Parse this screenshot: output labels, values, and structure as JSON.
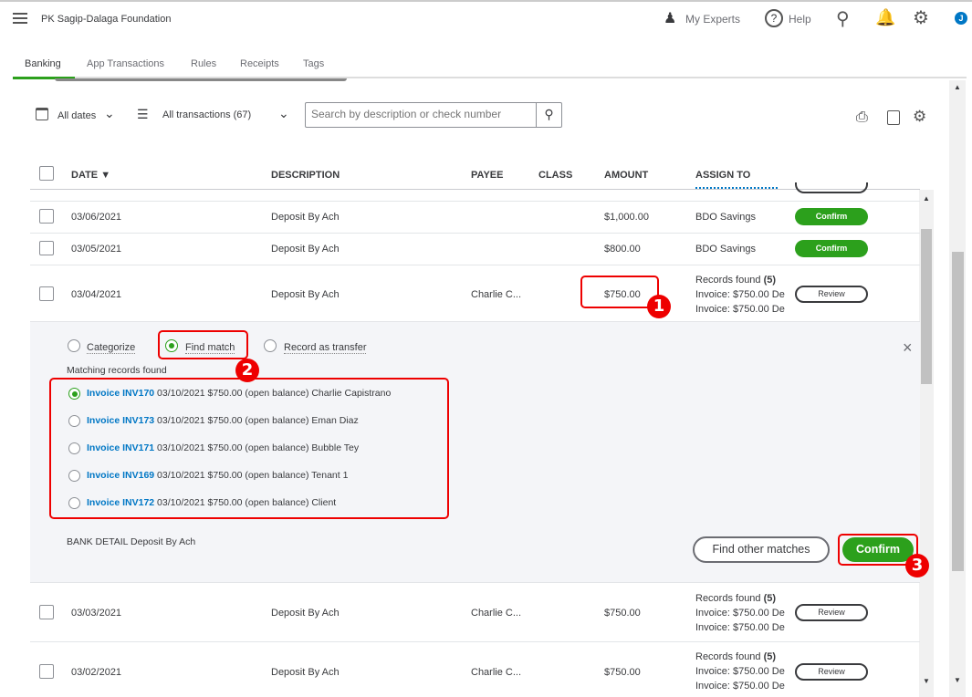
{
  "company": "PK Sagip-Dalaga Foundation",
  "header": {
    "my_experts": "My Experts",
    "help": "Help",
    "avatar": "J"
  },
  "tabs": [
    "Banking",
    "App Transactions",
    "Rules",
    "Receipts",
    "Tags"
  ],
  "filters": {
    "dates": "All dates",
    "transactions": "All transactions (67)",
    "search_placeholder": "Search by description or check number"
  },
  "columns": [
    "DATE",
    "DESCRIPTION",
    "PAYEE",
    "CLASS",
    "AMOUNT",
    "ASSIGN TO"
  ],
  "rows": [
    {
      "date": "03/06/2021",
      "description": "Deposit By Ach",
      "payee": "",
      "amount": "$1,000.00",
      "assign": "BDO Savings",
      "action": "Confirm"
    },
    {
      "date": "03/05/2021",
      "description": "Deposit By Ach",
      "payee": "",
      "amount": "$800.00",
      "assign": "BDO Savings",
      "action": "Confirm"
    },
    {
      "date": "03/04/2021",
      "description": "Deposit By Ach",
      "payee": "Charlie C...",
      "amount": "$750.00",
      "records": "Records found",
      "count": "(5)",
      "inv1": "Invoice: $750.00 De",
      "inv2": "Invoice: $750.00 De",
      "action": "Review"
    },
    {
      "date": "03/03/2021",
      "description": "Deposit By Ach",
      "payee": "Charlie C...",
      "amount": "$750.00",
      "records": "Records found",
      "count": "(5)",
      "inv1": "Invoice: $750.00 De",
      "inv2": "Invoice: $750.00 De",
      "action": "Review"
    },
    {
      "date": "03/02/2021",
      "description": "Deposit By Ach",
      "payee": "Charlie C...",
      "amount": "$750.00",
      "records": "Records found",
      "count": "(5)",
      "inv1": "Invoice: $750.00 De",
      "inv2": "Invoice: $750.00 De",
      "action": "Review"
    }
  ],
  "panel": {
    "opt_categorize": "Categorize",
    "opt_find": "Find match",
    "opt_transfer": "Record as transfer",
    "matching_label": "Matching records found",
    "matches": [
      {
        "inv": "Invoice INV170",
        "detail": "03/10/2021 $750.00 (open balance) Charlie Capistrano"
      },
      {
        "inv": "Invoice INV173",
        "detail": "03/10/2021 $750.00 (open balance) Eman Diaz"
      },
      {
        "inv": "Invoice INV171",
        "detail": "03/10/2021 $750.00 (open balance) Bubble Tey"
      },
      {
        "inv": "Invoice INV169",
        "detail": "03/10/2021 $750.00 (open balance) Tenant 1"
      },
      {
        "inv": "Invoice INV172",
        "detail": "03/10/2021 $750.00 (open balance) Client"
      }
    ],
    "bank_detail_label": "BANK DETAIL",
    "bank_detail": "Deposit By Ach",
    "find_other": "Find other matches",
    "confirm": "Confirm"
  },
  "annotations": [
    "1",
    "2",
    "3"
  ]
}
